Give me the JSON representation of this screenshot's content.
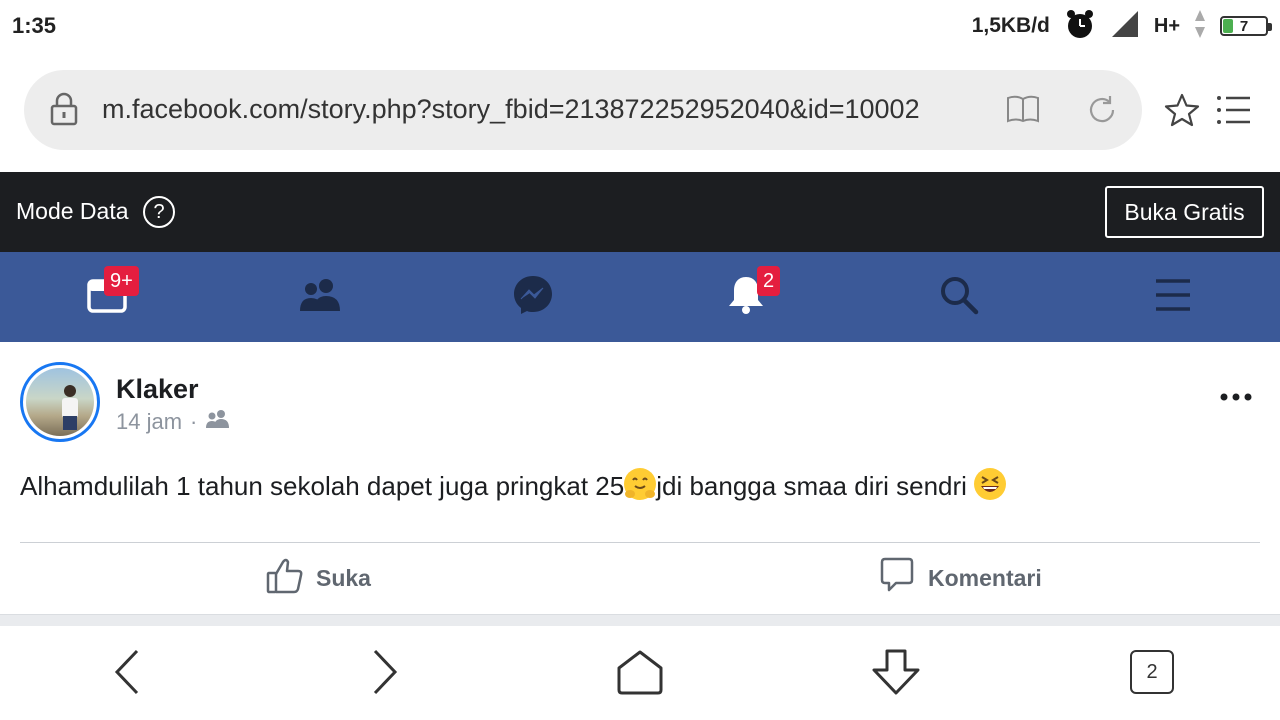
{
  "status_bar": {
    "time": "1:35",
    "net_speed": "1,5KB/d",
    "network": "H+",
    "battery": "7",
    "battery_level": 0.07,
    "icons": [
      "alarm-icon",
      "signal-icon",
      "data-arrows-icon",
      "battery-icon"
    ]
  },
  "browser": {
    "url": "m.facebook.com/story.php?story_fbid=213872252952040&id=10002",
    "tab_count": "2",
    "icons": [
      "lock-icon",
      "reader-icon",
      "reload-icon",
      "star-icon",
      "menu-icon",
      "back-icon",
      "forward-icon",
      "home-icon",
      "download-icon"
    ]
  },
  "data_mode": {
    "label": "Mode Data",
    "help": "?",
    "button": "Buka Gratis"
  },
  "fb_nav": {
    "items": [
      {
        "name": "news-feed-icon",
        "badge": "9+"
      },
      {
        "name": "friends-icon",
        "badge": ""
      },
      {
        "name": "messenger-icon",
        "badge": ""
      },
      {
        "name": "notifications-icon",
        "badge": "2"
      },
      {
        "name": "search-icon",
        "badge": ""
      },
      {
        "name": "menu-icon",
        "badge": ""
      }
    ],
    "colors": {
      "nav_bg": "#3b5998",
      "badge_bg": "#e41e3f"
    }
  },
  "post": {
    "author": "Klaker",
    "time": "14 jam",
    "separator": "·",
    "audience_icon": "friends-audience-icon",
    "text_part1": "Alhamdulilah 1 tahun sekolah dapet juga pringkat 25",
    "text_part2": "jdi bangga smaa diri sendri ",
    "emojis": [
      "hugging-face-emoji",
      "grinning-squinting-emoji"
    ],
    "actions": {
      "like": "Suka",
      "comment": "Komentari"
    }
  }
}
